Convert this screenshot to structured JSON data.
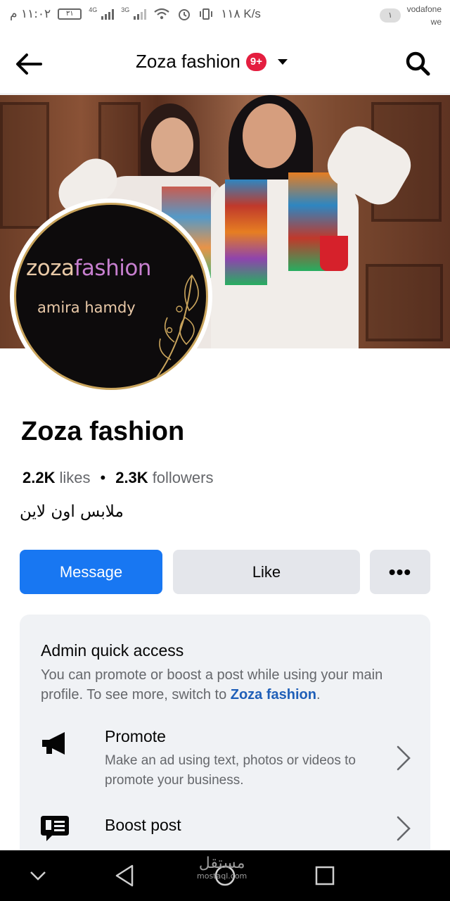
{
  "status_bar": {
    "time": "١١:٠٢ م",
    "battery": "٣١",
    "network1": "4G",
    "network2": "3G",
    "speed": "١١٨ K/s",
    "sim_indicator": "١",
    "carrier1": "vodafone",
    "carrier2": "we"
  },
  "header": {
    "title": "Zoza fashion",
    "badge": "9+"
  },
  "avatar": {
    "brand_part1": "zoza",
    "brand_part2": "fashion",
    "subtitle": "amira hamdy"
  },
  "profile": {
    "name": "Zoza fashion",
    "likes_count": "2.2K",
    "likes_label": "likes",
    "followers_count": "2.3K",
    "followers_label": "followers",
    "bio": "ملابس اون لاين"
  },
  "actions": {
    "message_label": "Message",
    "like_label": "Like",
    "more_label": "•••"
  },
  "admin": {
    "title": "Admin quick access",
    "desc": "You can promote or boost a post while using your main profile. To see more, switch to ",
    "link": "Zoza fashion",
    "desc_end": ".",
    "items": [
      {
        "title": "Promote",
        "desc": "Make an ad using text, photos or videos to promote your business.",
        "icon": "megaphone-icon"
      },
      {
        "title": "Boost post",
        "desc": "",
        "icon": "boost-post-icon"
      }
    ]
  },
  "nav": {
    "watermark": "مستقل",
    "watermark_sub": "mostaql.com"
  },
  "colors": {
    "accent": "#1877f2",
    "badge": "#e41e3f",
    "link": "#1f5fb8"
  }
}
